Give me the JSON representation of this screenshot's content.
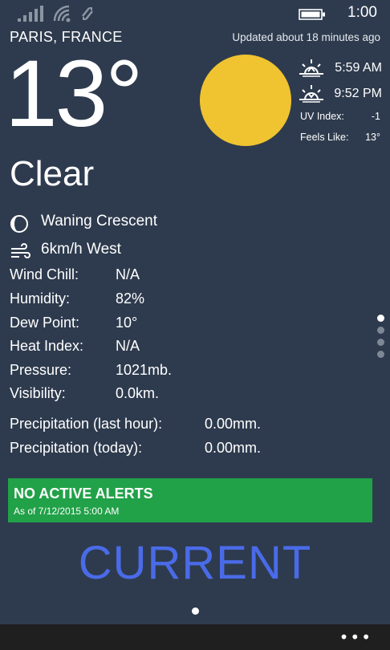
{
  "status_bar": {
    "time": "1:00"
  },
  "header": {
    "location": "PARIS, FRANCE",
    "updated": "Updated about 18 minutes ago"
  },
  "current": {
    "temperature": "13°",
    "condition": "Clear",
    "sunrise": "5:59 AM",
    "sunset": "9:52 PM",
    "uv_label": "UV Index:",
    "uv_value": "-1",
    "feels_label": "Feels Like:",
    "feels_value": "13°",
    "moon_phase": "Waning Crescent",
    "wind": "6km/h West"
  },
  "details": [
    {
      "label": "Wind Chill:",
      "value": "N/A"
    },
    {
      "label": "Humidity:",
      "value": "82%"
    },
    {
      "label": "Dew Point:",
      "value": "10°"
    },
    {
      "label": "Heat Index:",
      "value": "N/A"
    },
    {
      "label": "Pressure:",
      "value": "1021mb."
    },
    {
      "label": "Visibility:",
      "value": "0.0km."
    }
  ],
  "precipitation": [
    {
      "label": "Precipitation (last hour):",
      "value": "0.00mm."
    },
    {
      "label": "Precipitation (today):",
      "value": "0.00mm."
    }
  ],
  "alert": {
    "title": "NO ACTIVE ALERTS",
    "subtitle": "As of 7/12/2015 5:00 AM",
    "color": "#21a148"
  },
  "pivot": {
    "title": "CURRENT",
    "color": "#4a6be8"
  },
  "appbar": {
    "more": "•••"
  },
  "colors": {
    "background": "#2e3b4e",
    "sun": "#f0c330"
  },
  "icons": [
    "signal-icon",
    "wifi-icon",
    "data-sync-icon",
    "battery-icon",
    "sunrise-icon",
    "sunset-icon",
    "moon-icon",
    "wind-icon",
    "more-icon"
  ]
}
